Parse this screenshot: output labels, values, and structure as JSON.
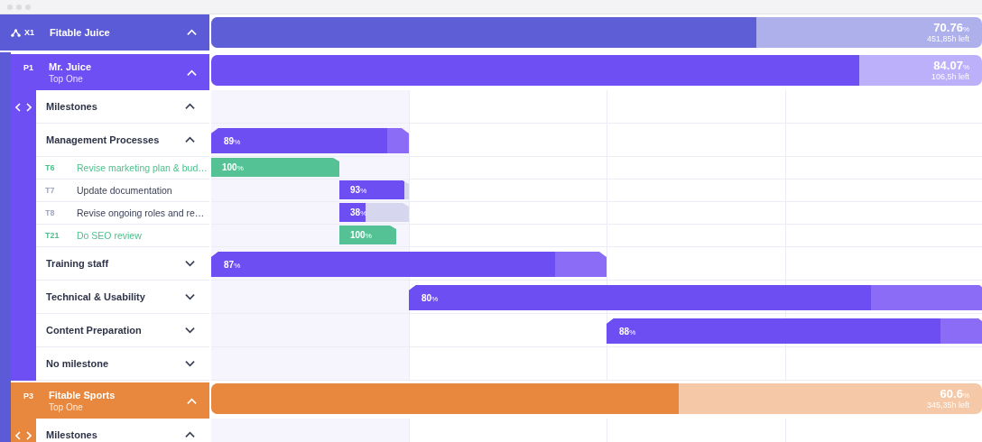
{
  "portfolio": {
    "code": "X1",
    "name": "Fitable Juice",
    "expanded": true,
    "level": 0.7076,
    "percent": "70.76",
    "unit": "%",
    "remaining": "451,85h left",
    "projects": [
      {
        "code": "P1",
        "name": "Mr. Juice",
        "subtitle": "Top One",
        "expanded": true,
        "color": "#6d4ff3",
        "level": 0.8407,
        "percent": "84.07",
        "unit": "%",
        "remaining": "106,5h left",
        "milestones_label": "Milestones",
        "milestones_expanded": true,
        "groups": [
          {
            "name": "Management Processes",
            "expanded": true,
            "level": 0.89,
            "percent": "89",
            "unit": "%",
            "tasks": [
              {
                "code": "T6",
                "name": "Revise marketing plan & bud…",
                "done": true,
                "level": 1,
                "percent": "100",
                "unit": "%"
              },
              {
                "code": "T7",
                "name": "Update documentation",
                "done": false,
                "level": 0.93,
                "percent": "93",
                "unit": "%"
              },
              {
                "code": "T8",
                "name": "Revise ongoing roles and re…",
                "done": false,
                "level": 0.38,
                "percent": "38",
                "unit": "%"
              },
              {
                "code": "T21",
                "name": "Do SEO review",
                "done": true,
                "level": 1,
                "percent": "100",
                "unit": "%"
              }
            ]
          },
          {
            "name": "Training staff",
            "expanded": false,
            "level": 0.87,
            "percent": "87",
            "unit": "%"
          },
          {
            "name": "Technical & Usability",
            "expanded": false,
            "level": 0.8,
            "percent": "80",
            "unit": "%"
          },
          {
            "name": "Content Preparation",
            "expanded": false,
            "level": 0.88,
            "percent": "88",
            "unit": "%"
          },
          {
            "name": "No milestone",
            "expanded": false
          }
        ]
      },
      {
        "code": "P3",
        "name": "Fitable Sports",
        "subtitle": "Top One",
        "expanded": true,
        "color": "#e8883e",
        "level": 0.606,
        "percent": "60.6",
        "unit": "%",
        "remaining": "345,35h left",
        "milestones_label": "Milestones",
        "milestones_expanded": true
      }
    ]
  }
}
